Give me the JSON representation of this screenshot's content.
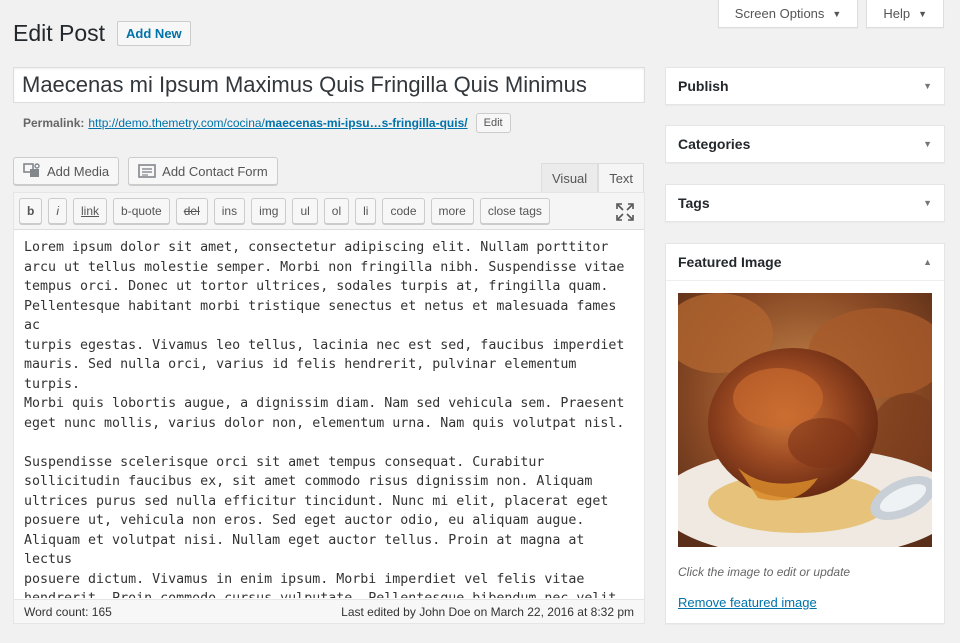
{
  "header": {
    "screen_options": "Screen Options",
    "help": "Help",
    "title": "Edit Post",
    "add_new": "Add New"
  },
  "post": {
    "title": "Maecenas mi Ipsum Maximus Quis Fringilla Quis Minimus",
    "permalink_label": "Permalink:",
    "permalink_prefix": "http://demo.themetry.com/cocina/",
    "permalink_slug": "maecenas-mi-ipsu…s-fringilla-quis/",
    "permalink_edit": "Edit"
  },
  "media": {
    "add_media": "Add Media",
    "add_contact_form": "Add Contact Form"
  },
  "editor": {
    "tabs": [
      "Visual",
      "Text"
    ],
    "active_tab": "Text",
    "quicktags": [
      "b",
      "i",
      "link",
      "b-quote",
      "del",
      "ins",
      "img",
      "ul",
      "ol",
      "li",
      "code",
      "more",
      "close tags"
    ],
    "paragraphs": [
      "Lorem ipsum dolor sit amet, consectetur adipiscing elit. Nullam porttitor\narcu ut tellus molestie semper. Morbi non fringilla nibh. Suspendisse vitae\ntempus orci. Donec ut tortor ultrices, sodales turpis at, fringilla quam.\nPellentesque habitant morbi tristique senectus et netus et malesuada fames ac\nturpis egestas. Vivamus leo tellus, lacinia nec est sed, faucibus imperdiet\nmauris. Sed nulla orci, varius id felis hendrerit, pulvinar elementum turpis.\nMorbi quis lobortis augue, a dignissim diam. Nam sed vehicula sem. Praesent\neget nunc mollis, varius dolor non, elementum urna. Nam quis volutpat nisl.",
      "Suspendisse scelerisque orci sit amet tempus consequat. Curabitur\nsollicitudin faucibus ex, sit amet commodo risus dignissim non. Aliquam\nultrices purus sed nulla efficitur tincidunt. Nunc mi elit, placerat eget\nposuere ut, vehicula non eros. Sed eget auctor odio, eu aliquam augue.\nAliquam et volutpat nisi. Nullam eget auctor tellus. Proin at magna at lectus\nposuere dictum. Vivamus in enim ipsum. Morbi imperdiet vel felis vitae\nhendrerit. Proin commodo cursus vulputate. Pellentesque bibendum nec velit\nvitae feugiat."
    ],
    "word_count": "Word count: 165",
    "last_edited": "Last edited by John Doe on March 22, 2016 at 8:32 pm"
  },
  "sidebar": {
    "publish": "Publish",
    "categories": "Categories",
    "tags": "Tags",
    "featured_image": "Featured Image",
    "featured_caption": "Click the image to edit or update",
    "remove_featured": "Remove featured image"
  },
  "colors": {
    "link": "#0073aa",
    "background": "#f1f1f1"
  }
}
